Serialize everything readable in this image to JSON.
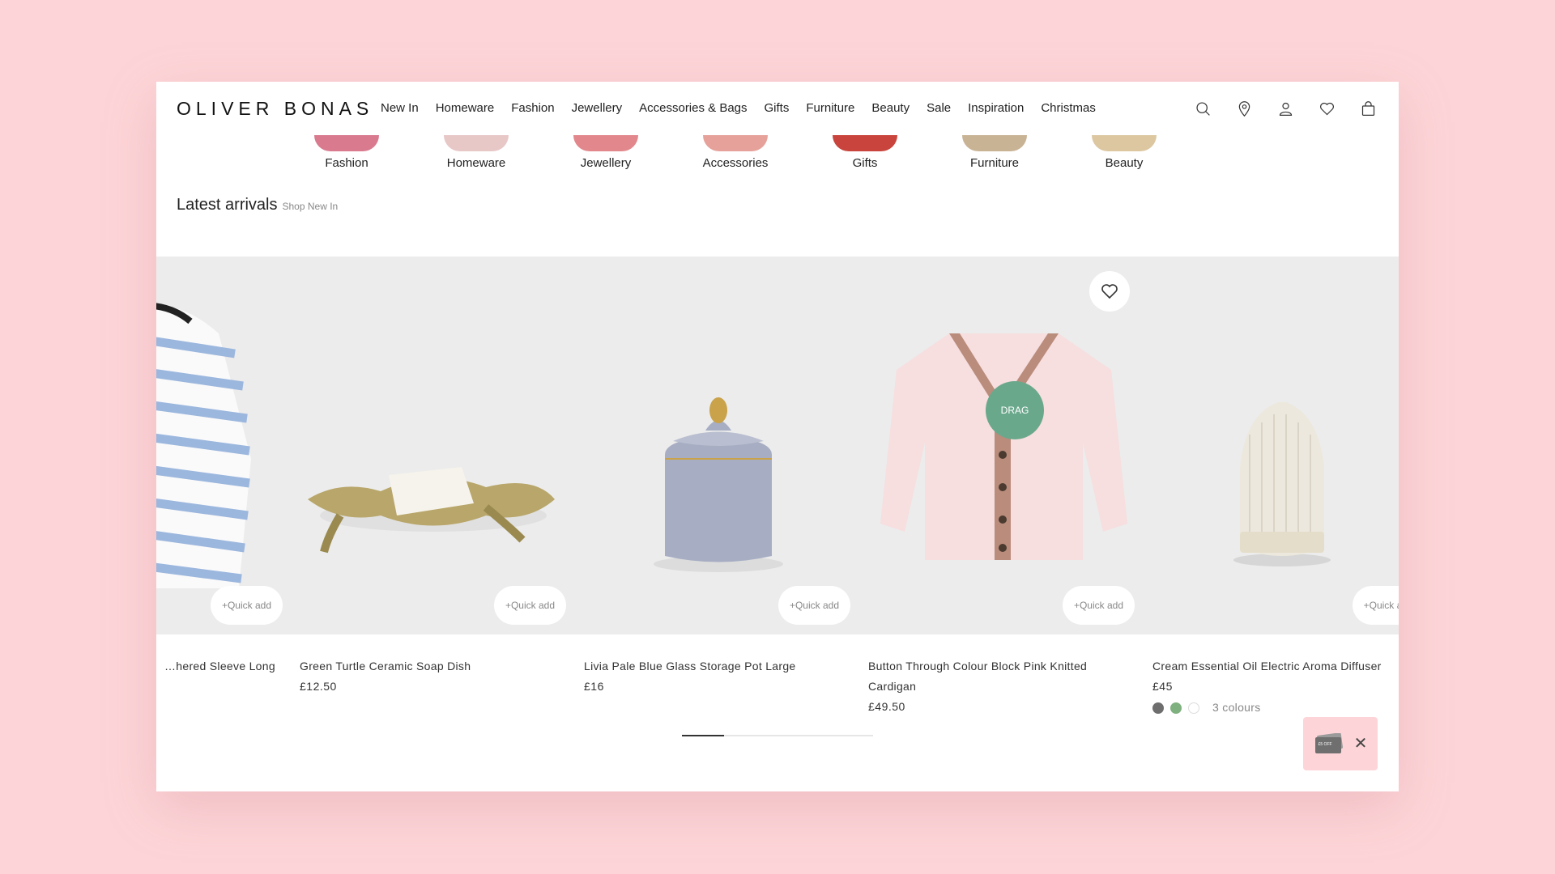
{
  "header": {
    "logo": "OLIVER BONAS",
    "nav": [
      "New In",
      "Homeware",
      "Fashion",
      "Jewellery",
      "Accessories & Bags",
      "Gifts",
      "Furniture",
      "Beauty",
      "Sale",
      "Inspiration",
      "Christmas"
    ],
    "icons": [
      "search-icon",
      "location-icon",
      "account-icon",
      "wishlist-icon",
      "bag-icon"
    ]
  },
  "categories": [
    {
      "label": "Fashion",
      "color": "#d97a8f"
    },
    {
      "label": "Homeware",
      "color": "#e8c7c7"
    },
    {
      "label": "Jewellery",
      "color": "#e2878c"
    },
    {
      "label": "Accessories",
      "color": "#e6a19a"
    },
    {
      "label": "Gifts",
      "color": "#c9443c"
    },
    {
      "label": "Furniture",
      "color": "#c9b395"
    },
    {
      "label": "Beauty",
      "color": "#dcc7a1"
    }
  ],
  "latest": {
    "title": "Latest arrivals",
    "link": "Shop New In"
  },
  "products": [
    {
      "name": "…hered Sleeve Long",
      "price": "",
      "quick_add": "+Quick add"
    },
    {
      "name": "Green Turtle Ceramic Soap Dish",
      "price": "£12.50",
      "quick_add": "+Quick add"
    },
    {
      "name": "Livia Pale Blue Glass Storage Pot Large",
      "price": "£16",
      "quick_add": "+Quick add"
    },
    {
      "name": "Button Through Colour Block Pink Knitted Cardigan",
      "price": "£49.50",
      "quick_add": "+Quick add"
    },
    {
      "name": "Cream Essential Oil Electric Aroma Diffuser",
      "price": "£45",
      "quick_add": "+Quick ad",
      "swatches": [
        "#6e6e6e",
        "#7fb07f",
        "#ffffff"
      ],
      "colours": "3 colours"
    }
  ],
  "drag_label": "DRAG",
  "carousel_progress": 0.22,
  "voucher": {
    "text": "£5 OFF",
    "close": "✕"
  },
  "colors": {
    "background": "#fdd5d8",
    "accent": "#6aa88c"
  }
}
